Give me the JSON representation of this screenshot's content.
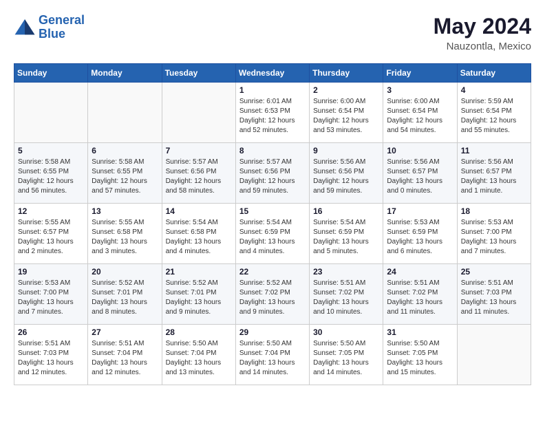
{
  "header": {
    "logo_line1": "General",
    "logo_line2": "Blue",
    "month_year": "May 2024",
    "location": "Nauzontla, Mexico"
  },
  "days_of_week": [
    "Sunday",
    "Monday",
    "Tuesday",
    "Wednesday",
    "Thursday",
    "Friday",
    "Saturday"
  ],
  "weeks": [
    [
      {
        "day": "",
        "content": ""
      },
      {
        "day": "",
        "content": ""
      },
      {
        "day": "",
        "content": ""
      },
      {
        "day": "1",
        "content": "Sunrise: 6:01 AM\nSunset: 6:53 PM\nDaylight: 12 hours\nand 52 minutes."
      },
      {
        "day": "2",
        "content": "Sunrise: 6:00 AM\nSunset: 6:54 PM\nDaylight: 12 hours\nand 53 minutes."
      },
      {
        "day": "3",
        "content": "Sunrise: 6:00 AM\nSunset: 6:54 PM\nDaylight: 12 hours\nand 54 minutes."
      },
      {
        "day": "4",
        "content": "Sunrise: 5:59 AM\nSunset: 6:54 PM\nDaylight: 12 hours\nand 55 minutes."
      }
    ],
    [
      {
        "day": "5",
        "content": "Sunrise: 5:58 AM\nSunset: 6:55 PM\nDaylight: 12 hours\nand 56 minutes."
      },
      {
        "day": "6",
        "content": "Sunrise: 5:58 AM\nSunset: 6:55 PM\nDaylight: 12 hours\nand 57 minutes."
      },
      {
        "day": "7",
        "content": "Sunrise: 5:57 AM\nSunset: 6:56 PM\nDaylight: 12 hours\nand 58 minutes."
      },
      {
        "day": "8",
        "content": "Sunrise: 5:57 AM\nSunset: 6:56 PM\nDaylight: 12 hours\nand 59 minutes."
      },
      {
        "day": "9",
        "content": "Sunrise: 5:56 AM\nSunset: 6:56 PM\nDaylight: 12 hours\nand 59 minutes."
      },
      {
        "day": "10",
        "content": "Sunrise: 5:56 AM\nSunset: 6:57 PM\nDaylight: 13 hours\nand 0 minutes."
      },
      {
        "day": "11",
        "content": "Sunrise: 5:56 AM\nSunset: 6:57 PM\nDaylight: 13 hours\nand 1 minute."
      }
    ],
    [
      {
        "day": "12",
        "content": "Sunrise: 5:55 AM\nSunset: 6:57 PM\nDaylight: 13 hours\nand 2 minutes."
      },
      {
        "day": "13",
        "content": "Sunrise: 5:55 AM\nSunset: 6:58 PM\nDaylight: 13 hours\nand 3 minutes."
      },
      {
        "day": "14",
        "content": "Sunrise: 5:54 AM\nSunset: 6:58 PM\nDaylight: 13 hours\nand 4 minutes."
      },
      {
        "day": "15",
        "content": "Sunrise: 5:54 AM\nSunset: 6:59 PM\nDaylight: 13 hours\nand 4 minutes."
      },
      {
        "day": "16",
        "content": "Sunrise: 5:54 AM\nSunset: 6:59 PM\nDaylight: 13 hours\nand 5 minutes."
      },
      {
        "day": "17",
        "content": "Sunrise: 5:53 AM\nSunset: 6:59 PM\nDaylight: 13 hours\nand 6 minutes."
      },
      {
        "day": "18",
        "content": "Sunrise: 5:53 AM\nSunset: 7:00 PM\nDaylight: 13 hours\nand 7 minutes."
      }
    ],
    [
      {
        "day": "19",
        "content": "Sunrise: 5:53 AM\nSunset: 7:00 PM\nDaylight: 13 hours\nand 7 minutes."
      },
      {
        "day": "20",
        "content": "Sunrise: 5:52 AM\nSunset: 7:01 PM\nDaylight: 13 hours\nand 8 minutes."
      },
      {
        "day": "21",
        "content": "Sunrise: 5:52 AM\nSunset: 7:01 PM\nDaylight: 13 hours\nand 9 minutes."
      },
      {
        "day": "22",
        "content": "Sunrise: 5:52 AM\nSunset: 7:02 PM\nDaylight: 13 hours\nand 9 minutes."
      },
      {
        "day": "23",
        "content": "Sunrise: 5:51 AM\nSunset: 7:02 PM\nDaylight: 13 hours\nand 10 minutes."
      },
      {
        "day": "24",
        "content": "Sunrise: 5:51 AM\nSunset: 7:02 PM\nDaylight: 13 hours\nand 11 minutes."
      },
      {
        "day": "25",
        "content": "Sunrise: 5:51 AM\nSunset: 7:03 PM\nDaylight: 13 hours\nand 11 minutes."
      }
    ],
    [
      {
        "day": "26",
        "content": "Sunrise: 5:51 AM\nSunset: 7:03 PM\nDaylight: 13 hours\nand 12 minutes."
      },
      {
        "day": "27",
        "content": "Sunrise: 5:51 AM\nSunset: 7:04 PM\nDaylight: 13 hours\nand 12 minutes."
      },
      {
        "day": "28",
        "content": "Sunrise: 5:50 AM\nSunset: 7:04 PM\nDaylight: 13 hours\nand 13 minutes."
      },
      {
        "day": "29",
        "content": "Sunrise: 5:50 AM\nSunset: 7:04 PM\nDaylight: 13 hours\nand 14 minutes."
      },
      {
        "day": "30",
        "content": "Sunrise: 5:50 AM\nSunset: 7:05 PM\nDaylight: 13 hours\nand 14 minutes."
      },
      {
        "day": "31",
        "content": "Sunrise: 5:50 AM\nSunset: 7:05 PM\nDaylight: 13 hours\nand 15 minutes."
      },
      {
        "day": "",
        "content": ""
      }
    ]
  ]
}
